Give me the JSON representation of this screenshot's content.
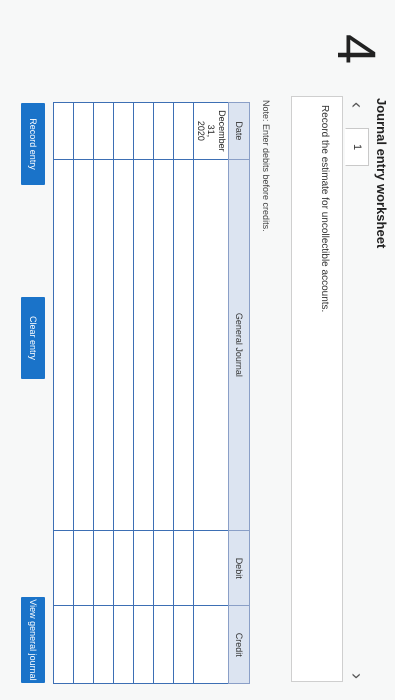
{
  "question_number": "4",
  "title": "Journal entry worksheet",
  "nav": {
    "prev_icon": "‹",
    "page": "1",
    "next_icon": "›"
  },
  "prompt": "Record the estimate for uncollectible accounts.",
  "note": "Note: Enter debits before credits.",
  "table": {
    "headers": {
      "date": "Date",
      "journal": "General Journal",
      "debit": "Debit",
      "credit": "Credit"
    },
    "first_date_line1": "December 31,",
    "first_date_line2": "2020",
    "row_count": 8
  },
  "buttons": {
    "record": "Record entry",
    "clear": "Clear entry",
    "view": "View general journal"
  },
  "colors": {
    "accent": "#1a73c9",
    "grid": "#3d6fb4",
    "header_bg": "#dce4f1"
  }
}
